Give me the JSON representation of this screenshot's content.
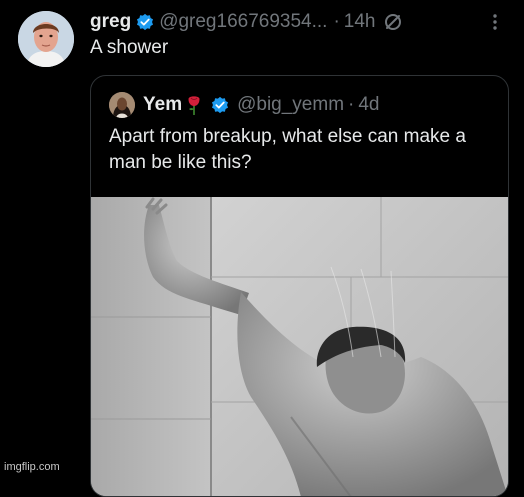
{
  "tweet": {
    "display_name": "greg",
    "handle": "@greg166769354...",
    "separator": "·",
    "age": "14h",
    "text": "A shower",
    "verified_color": "#1d9bf0"
  },
  "quote": {
    "display_name": "Yem",
    "handle": "@big_yemm",
    "separator": "·",
    "age": "4d",
    "text": "Apart from breakup, what else can make a man be like this?",
    "verified_color": "#1d9bf0"
  },
  "watermark": "imgflip.com",
  "icons": {
    "verified": "verified-badge-icon",
    "edit": "edited-icon",
    "more": "more-options-icon",
    "rose": "rose-emoji-icon"
  },
  "colors": {
    "background": "#000000",
    "primary_text": "#e7e9ea",
    "secondary_text": "#71767b",
    "border": "#2f3336"
  }
}
